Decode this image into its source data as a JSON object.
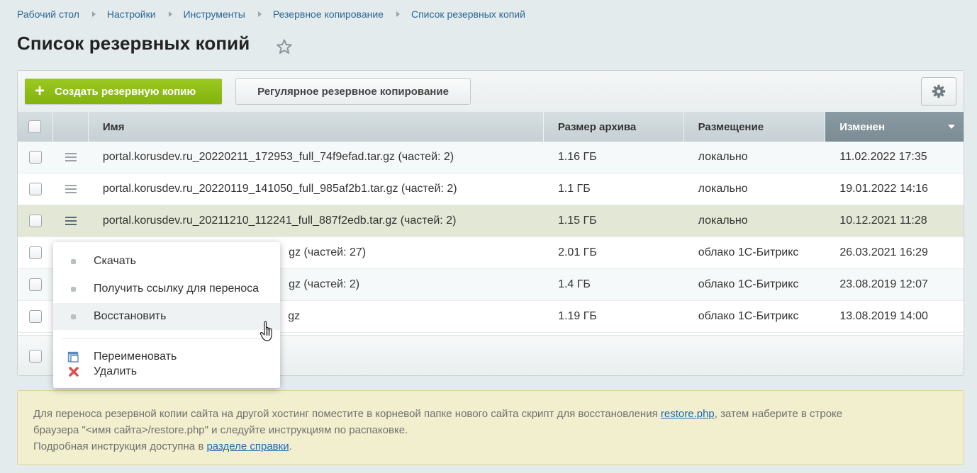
{
  "breadcrumbs": [
    "Рабочий стол",
    "Настройки",
    "Инструменты",
    "Резервное копирование",
    "Список резервных копий"
  ],
  "page_title": "Список резервных копий",
  "toolbar": {
    "create_label": "Создать резервную копию",
    "regular_label": "Регулярное резервное копирование"
  },
  "table": {
    "headers": {
      "name": "Имя",
      "size": "Размер архива",
      "place": "Размещение",
      "date": "Изменен"
    },
    "rows": [
      {
        "name": "portal.korusdev.ru_20220211_172953_full_74f9efad.tar.gz (частей: 2)",
        "size": "1.16 ГБ",
        "place": "локально",
        "date": "11.02.2022 17:35"
      },
      {
        "name": "portal.korusdev.ru_20220119_141050_full_985af2b1.tar.gz (частей: 2)",
        "size": "1.1 ГБ",
        "place": "локально",
        "date": "19.01.2022 14:16"
      },
      {
        "name": "portal.korusdev.ru_20211210_112241_full_887f2edb.tar.gz (частей: 2)",
        "size": "1.15 ГБ",
        "place": "локально",
        "date": "10.12.2021 11:28"
      },
      {
        "name": "gz (частей: 27)",
        "size": "2.01 ГБ",
        "place": "облако 1С-Битрикс",
        "date": "26.03.2021 16:29"
      },
      {
        "name": "gz (частей: 2)",
        "size": "1.4 ГБ",
        "place": "облако 1С-Битрикс",
        "date": "23.08.2019 12:07"
      },
      {
        "name": "gz",
        "size": "1.19 ГБ",
        "place": "облако 1С-Битрикс",
        "date": "13.08.2019 14:00"
      }
    ]
  },
  "context_menu": {
    "download": "Скачать",
    "get_link": "Получить ссылку для переноса",
    "restore": "Восстановить",
    "rename": "Переименовать",
    "delete": "Удалить"
  },
  "note": {
    "line1_prefix": "Для переноса резервной копии сайта на другой хостинг поместите в корневой папке нового сайта скрипт для восстановления ",
    "restore_link": "restore.php",
    "line1_suffix": ", затем наберите в строке",
    "line2": "браузера \"<имя сайта>/restore.php\" и следуйте инструкциям по распаковке.",
    "line3_prefix": "Подробная инструкция доступна в ",
    "help_link": "разделе справки",
    "line3_suffix": "."
  },
  "colors": {
    "accent_green": "#8fbd17",
    "link_blue": "#2c6796",
    "selected_row": "#e2e8d5",
    "note_bg": "#f1efcd"
  }
}
